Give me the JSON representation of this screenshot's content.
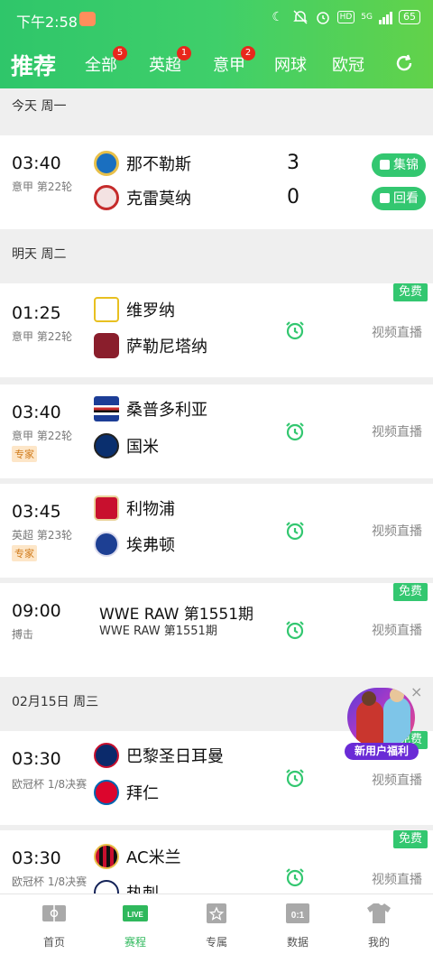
{
  "status_bar": {
    "time": "下午2:58",
    "network": "5G",
    "battery": "65"
  },
  "header": {
    "title": "推荐",
    "tabs": [
      {
        "label": "全部",
        "badge": "5"
      },
      {
        "label": "英超",
        "badge": "1"
      },
      {
        "label": "意甲",
        "badge": "2"
      },
      {
        "label": "网球",
        "badge": ""
      },
      {
        "label": "欧冠",
        "badge": ""
      }
    ]
  },
  "sections": [
    {
      "date": "今天 周一"
    },
    {
      "date": "明天 周二"
    },
    {
      "date": "02月15日 周三"
    }
  ],
  "matches": [
    {
      "time": "03:40",
      "league": "意甲 第22轮",
      "home": "那不勒斯",
      "away": "克雷莫纳",
      "home_score": "3",
      "away_score": "0",
      "actions": [
        "集锦",
        "回看"
      ]
    },
    {
      "time": "01:25",
      "league": "意甲 第22轮",
      "home": "维罗纳",
      "away": "萨勒尼塔纳",
      "free": "免费",
      "live": "视频直播"
    },
    {
      "time": "03:40",
      "league": "意甲 第22轮",
      "expert": "专家",
      "home": "桑普多利亚",
      "away": "国米",
      "live": "视频直播"
    },
    {
      "time": "03:45",
      "league": "英超 第23轮",
      "expert": "专家",
      "home": "利物浦",
      "away": "埃弗顿",
      "live": "视频直播"
    },
    {
      "time": "09:00",
      "league": "搏击",
      "free": "免费",
      "title": "WWE RAW 第1551期",
      "subtitle": "WWE RAW 第1551期",
      "live": "视频直播"
    },
    {
      "time": "03:30",
      "league": "欧冠杯 1/8决赛",
      "free": "免费",
      "home": "巴黎圣日耳曼",
      "away": "拜仁",
      "live": "视频直播"
    },
    {
      "time": "03:30",
      "league": "欧冠杯 1/8决赛",
      "free": "免费",
      "home": "AC米兰",
      "away": "热刺",
      "live": "视频直播"
    }
  ],
  "promo": {
    "label": "新用户福利",
    "close": "×"
  },
  "bottom_nav": [
    {
      "label": "首页",
      "badge": ""
    },
    {
      "label": "赛程",
      "badge": "LIVE"
    },
    {
      "label": "专属",
      "badge": ""
    },
    {
      "label": "数据",
      "badge": "0:1"
    },
    {
      "label": "我的",
      "badge": ""
    }
  ],
  "colors": {
    "brand": "#33c770",
    "badge": "#e8271c",
    "bg": "#efefef"
  }
}
